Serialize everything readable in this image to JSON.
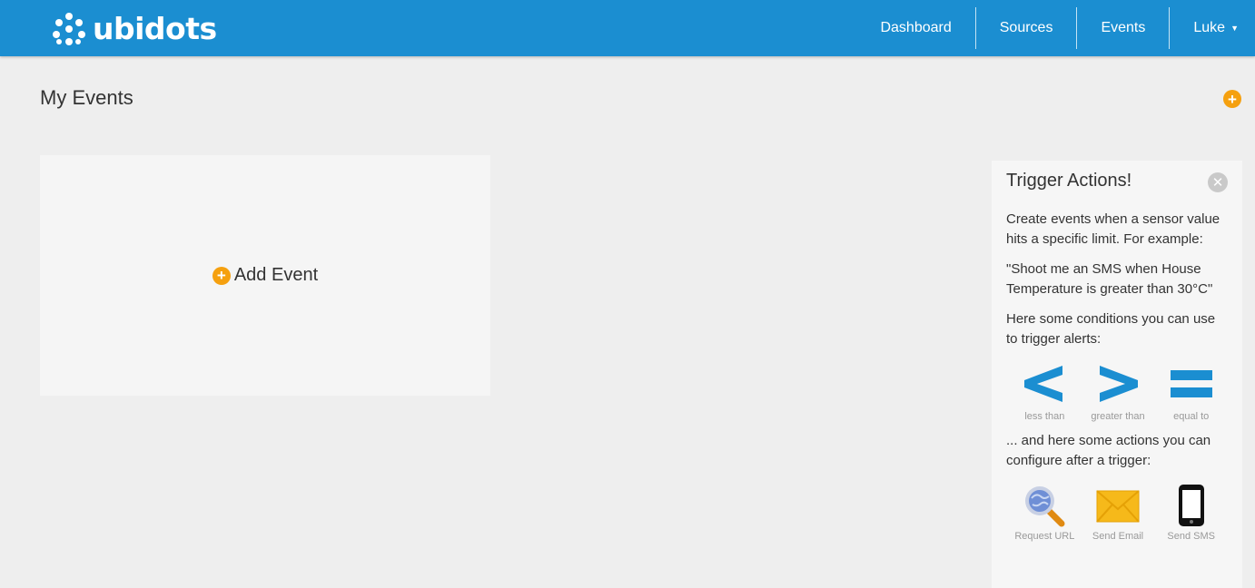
{
  "header": {
    "brand": "ubidots",
    "nav": [
      {
        "label": "Dashboard"
      },
      {
        "label": "Sources"
      },
      {
        "label": "Events"
      },
      {
        "label": "Luke"
      }
    ],
    "colors": {
      "bar": "#1b8ed1"
    }
  },
  "main": {
    "title": "My Events",
    "add_event_label": "Add Event",
    "accent_color": "#f5a00f"
  },
  "panel": {
    "title": "Trigger Actions!",
    "intro": "Create events when a sensor value hits a specific limit. For example:",
    "example": "\"Shoot me an SMS when House Temperature is greater than 30°C\"",
    "conditions_text": "Here some conditions you can use to trigger alerts:",
    "conditions": [
      {
        "icon": "less-than-icon",
        "label": "less than"
      },
      {
        "icon": "greater-than-icon",
        "label": "greater than"
      },
      {
        "icon": "equal-to-icon",
        "label": "equal to"
      }
    ],
    "actions_text": "... and here some actions you can configure after a trigger:",
    "actions": [
      {
        "icon": "globe-search-icon",
        "label": "Request URL"
      },
      {
        "icon": "envelope-icon",
        "label": "Send Email"
      },
      {
        "icon": "phone-icon",
        "label": "Send SMS"
      }
    ]
  }
}
